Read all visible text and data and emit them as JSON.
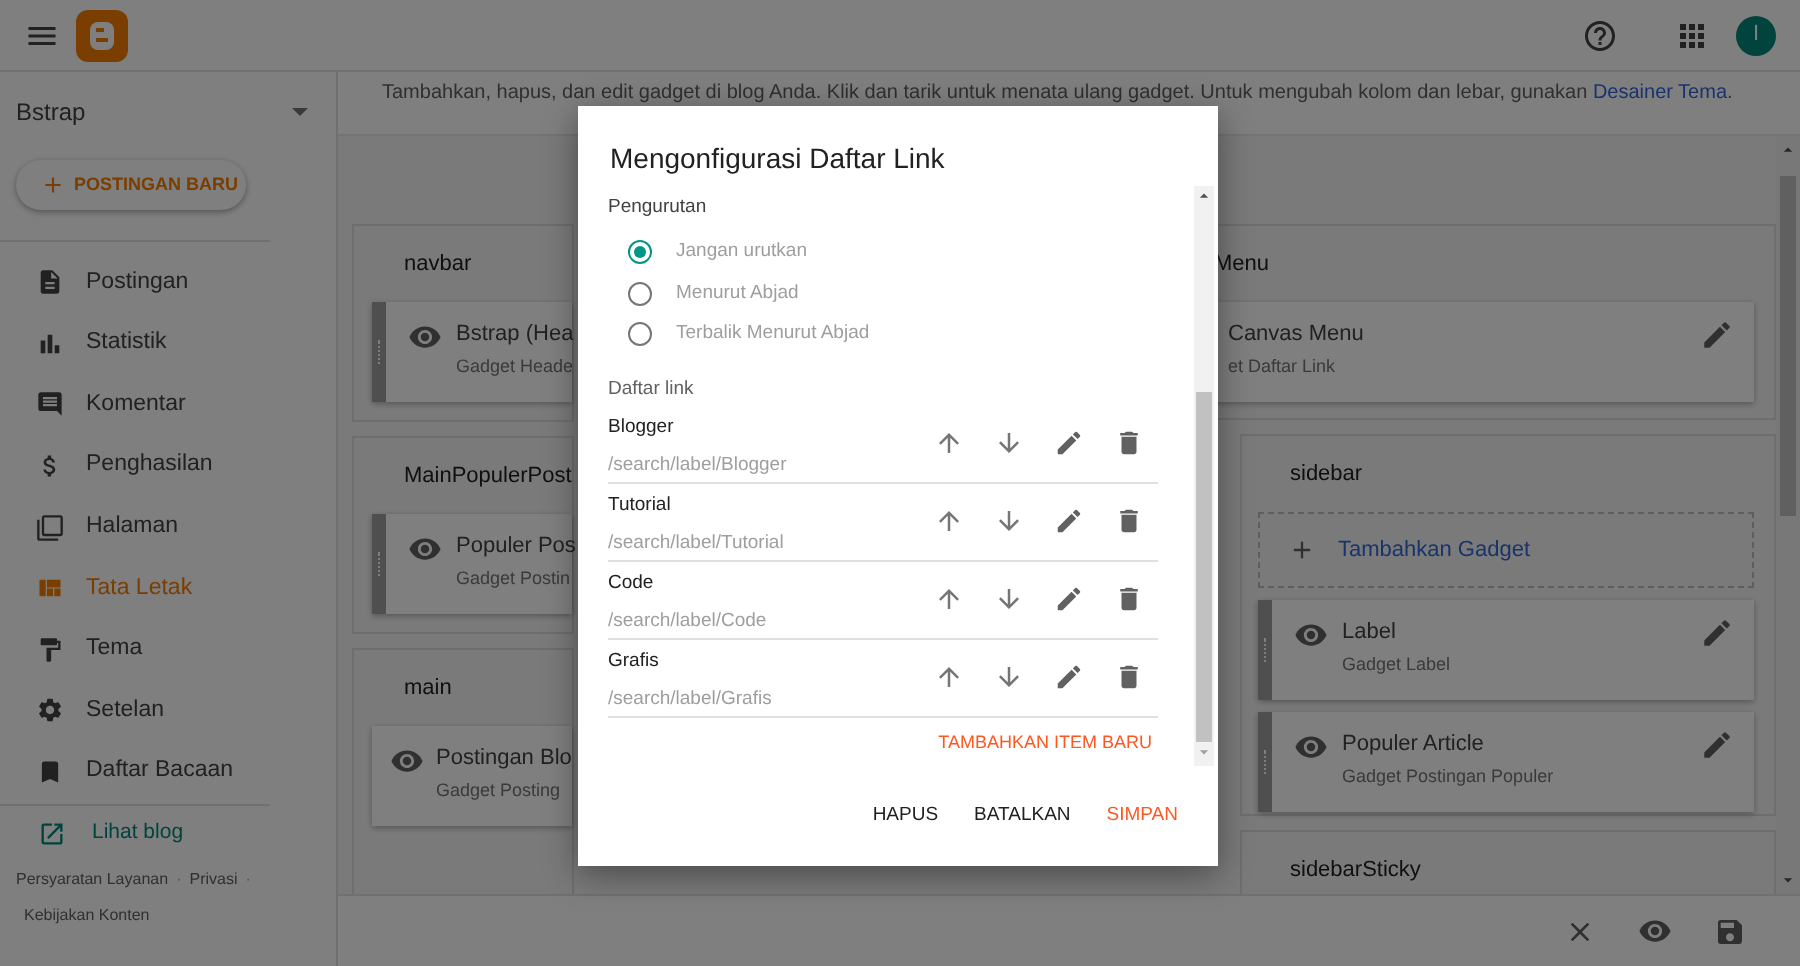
{
  "app_bar": {
    "avatar": "I"
  },
  "sidebar": {
    "blog_name": "Bstrap",
    "new_post_button": "POSTINGAN BARU",
    "items": [
      {
        "label": "Postingan",
        "selected": false
      },
      {
        "label": "Statistik",
        "selected": false
      },
      {
        "label": "Komentar",
        "selected": false
      },
      {
        "label": "Penghasilan",
        "selected": false
      },
      {
        "label": "Halaman",
        "selected": false
      },
      {
        "label": "Tata Letak",
        "selected": true
      },
      {
        "label": "Tema",
        "selected": false
      },
      {
        "label": "Setelan",
        "selected": false
      },
      {
        "label": "Daftar Bacaan",
        "selected": false
      }
    ],
    "view_blog": "Lihat blog",
    "footer_links": [
      "Persyaratan Layanan",
      "Privasi",
      "Kebijakan Konten"
    ],
    "footer_separator": "·"
  },
  "layout": {
    "info_text": "Tambahkan, hapus, dan edit gadget di blog Anda. Klik dan tarik untuk menata ulang gadget. Untuk mengubah kolom dan lebar, gunakan",
    "info_link": "Desainer Tema",
    "info_end": ".",
    "left_sections": [
      {
        "title": "navbar",
        "gadgets": [
          {
            "name": "Bstrap (Hea",
            "type": "Gadget Heade",
            "handle": true,
            "eye": true
          }
        ]
      },
      {
        "title": "MainPopulerPost",
        "gadgets": [
          {
            "name": "Populer Pos",
            "type": "Gadget Postin",
            "handle": true,
            "eye": true
          }
        ]
      },
      {
        "title": "main",
        "gadgets": [
          {
            "name": "Postingan Blo",
            "type": "Gadget Posting",
            "handle": false,
            "eye": true
          }
        ]
      }
    ],
    "right_sections": [
      {
        "title": "Menu",
        "gadgets": [
          {
            "name": "Canvas Menu",
            "type": "et Daftar Link",
            "handle": false,
            "eye": false
          }
        ]
      },
      {
        "title": "sidebar",
        "add_gadget": "Tambahkan Gadget",
        "gadgets": [
          {
            "name": "Label",
            "type": "Gadget Label",
            "handle": true,
            "eye": true
          },
          {
            "name": "Populer Article",
            "type": "Gadget Postingan Populer",
            "handle": true,
            "eye": true
          }
        ]
      },
      {
        "title": "sidebarSticky"
      }
    ]
  },
  "dialog": {
    "title": "Mengonfigurasi Daftar Link",
    "sort_label": "Pengurutan",
    "sort_options": [
      {
        "label": "Jangan urutkan",
        "selected": true
      },
      {
        "label": "Menurut Abjad",
        "selected": false
      },
      {
        "label": "Terbalik Menurut Abjad",
        "selected": false
      }
    ],
    "links_label": "Daftar link",
    "links": [
      {
        "name": "Blogger",
        "url": "/search/label/Blogger"
      },
      {
        "name": "Tutorial",
        "url": "/search/label/Tutorial"
      },
      {
        "name": "Code",
        "url": "/search/label/Code"
      },
      {
        "name": "Grafis",
        "url": "/search/label/Grafis"
      }
    ],
    "add_item": "TAMBAHKAN ITEM BARU",
    "buttons": [
      {
        "label": "HAPUS",
        "kind": "default"
      },
      {
        "label": "BATALKAN",
        "kind": "default"
      },
      {
        "label": "SIMPAN",
        "kind": "primary"
      }
    ]
  }
}
